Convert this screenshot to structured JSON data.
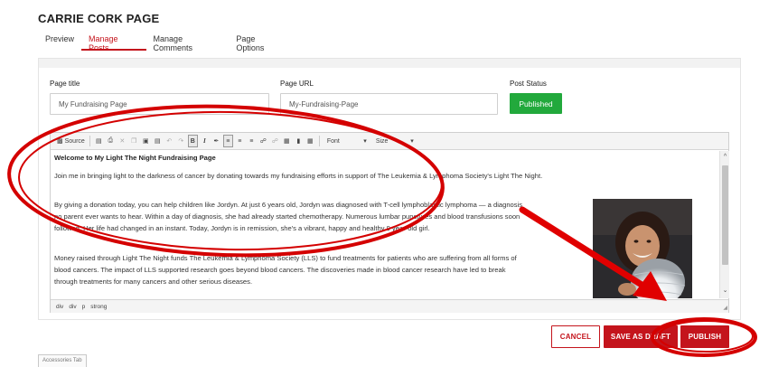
{
  "page": {
    "title": "CARRIE CORK PAGE"
  },
  "tabs": [
    {
      "label": "Preview",
      "active": false
    },
    {
      "label": "Manage Posts",
      "active": true
    },
    {
      "label": "Manage Comments",
      "active": false
    },
    {
      "label": "Page Options",
      "active": false
    }
  ],
  "form": {
    "page_title": {
      "label": "Page title",
      "value": "My Fundraising Page"
    },
    "page_url": {
      "label": "Page URL",
      "value": "My-Fundraising-Page"
    },
    "post_status": {
      "label": "Post Status",
      "value": "Published"
    }
  },
  "editor": {
    "toolbar": {
      "source_label": "Source",
      "bold": "B",
      "italic": "I",
      "font_label": "Font",
      "size_label": "Size"
    },
    "content": {
      "heading": "Welcome to My Light The Night Fundraising Page",
      "p1": "Join me in bringing light to the darkness of cancer by donating towards my fundraising efforts in support of The Leukemia & Lymphoma Society's Light The Night.",
      "p2_l1": "By giving a donation today, you can help children like Jordyn. At just 6 years old, Jordyn was diagnosed with T-cell lymphoblastic lymphoma — a diagnosis",
      "p2_l2": "no parent ever wants to hear. Within a day of diagnosis, she had already started chemotherapy. Numerous lumbar punctures and blood transfusions soon",
      "p2_l3": "followed. Her life had changed in an instant. Today, Jordyn is in remission, she's a vibrant, happy and healthy 9 year-old girl.",
      "p3_l1": "Money raised through Light The Night funds The Leukemia & Lymphoma Society (LLS) to fund treatments for patients who are suffering from all forms of",
      "p3_l2": "blood cancers. The impact of LLS supported research goes beyond blood cancers. The discoveries made in blood cancer research have led to break",
      "p3_l3": "through treatments for many cancers and other serious diseases."
    },
    "path": [
      "div",
      "div",
      "p",
      "strong"
    ]
  },
  "actions": {
    "cancel": "CANCEL",
    "save_draft": "SAVE AS DRAFT",
    "publish": "PUBLISH"
  },
  "bottom_tab": {
    "label": "Accessories Tab"
  },
  "colors": {
    "brand_red": "#c4141c",
    "status_green": "#22a93c",
    "annotation_red": "#d40000"
  },
  "icons": [
    "source-icon",
    "preview-icon",
    "print-icon",
    "cut-icon",
    "copy-icon",
    "paste-icon",
    "paste-text-icon",
    "undo-icon",
    "redo-icon",
    "remove-format-icon",
    "align-left-icon",
    "align-center-icon",
    "align-justify-icon",
    "link-icon",
    "unlink-icon",
    "image-icon",
    "video-icon",
    "table-icon"
  ]
}
